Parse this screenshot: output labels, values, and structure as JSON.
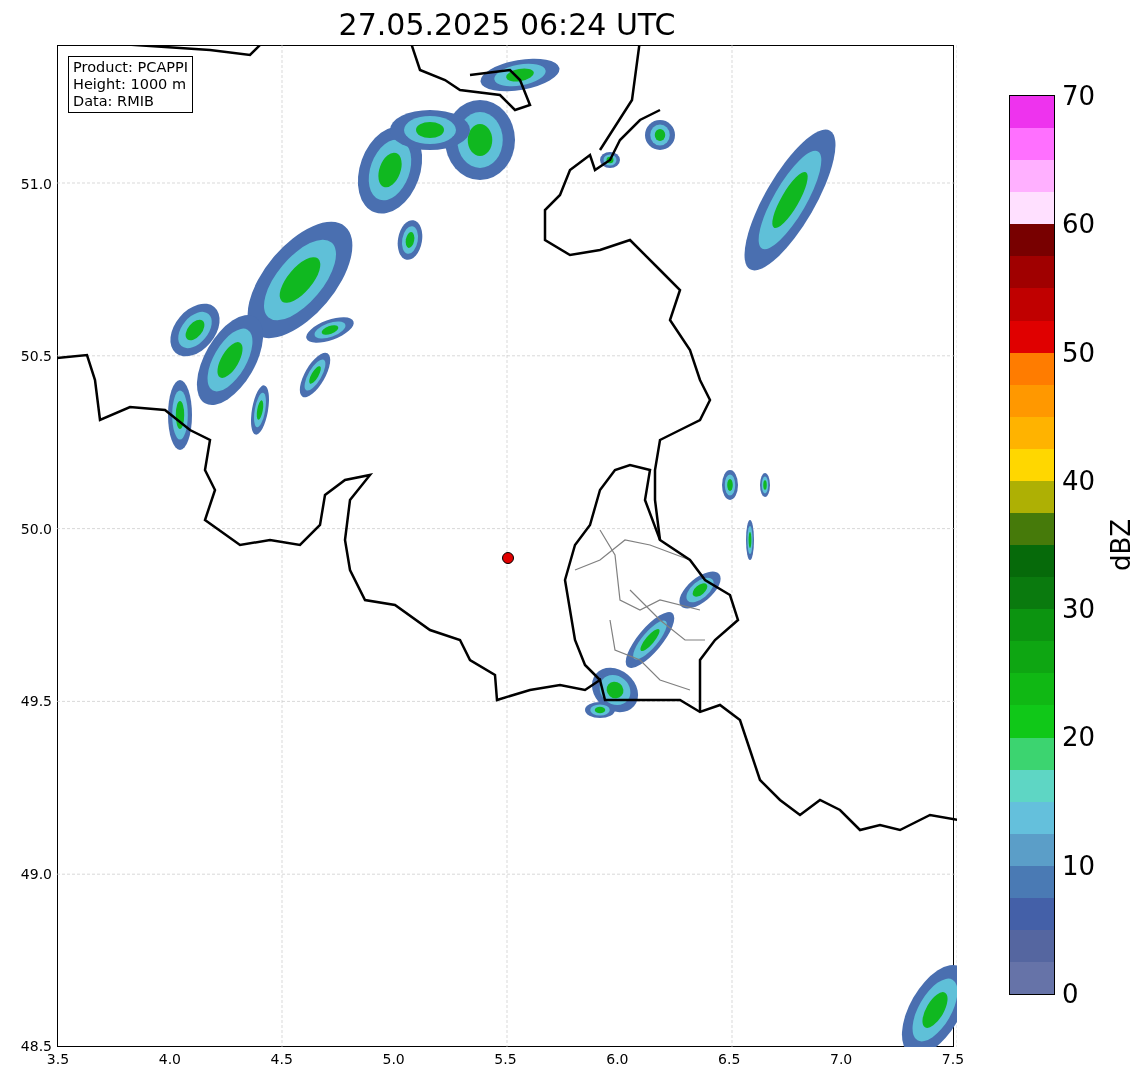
{
  "title": "27.05.2025 06:24 UTC",
  "info_box": [
    "Product: PCAPPI",
    "Height: 1000 m",
    "Data: RMIB"
  ],
  "map": {
    "xticks": [
      "3.5",
      "4.0",
      "4.5",
      "5.0",
      "5.5",
      "6.0",
      "6.5",
      "7.0",
      "7.5"
    ],
    "yticks": [
      "51.0",
      "50.5",
      "50.0",
      "49.5",
      "49.0",
      "48.5"
    ]
  },
  "colorbar": {
    "label": "dBZ",
    "ticks": [
      "70",
      "60",
      "50",
      "40",
      "30",
      "20",
      "10",
      "0"
    ],
    "segments": [
      {
        "color": "#6673a8"
      },
      {
        "color": "#5566a0"
      },
      {
        "color": "#4460a8"
      },
      {
        "color": "#4a7ab4"
      },
      {
        "color": "#5b9ec8"
      },
      {
        "color": "#64c0dc"
      },
      {
        "color": "#5ed6c4"
      },
      {
        "color": "#3cd470"
      },
      {
        "color": "#10c818"
      },
      {
        "color": "#10b814"
      },
      {
        "color": "#0ea612"
      },
      {
        "color": "#0c9410"
      },
      {
        "color": "#0a7a0e"
      },
      {
        "color": "#066a0a"
      },
      {
        "color": "#467a0a"
      },
      {
        "color": "#aeb004"
      },
      {
        "color": "#ffd700"
      },
      {
        "color": "#ffb300"
      },
      {
        "color": "#ff9800"
      },
      {
        "color": "#ff7c00"
      },
      {
        "color": "#e00000"
      },
      {
        "color": "#c00000"
      },
      {
        "color": "#a00000"
      },
      {
        "color": "#780000"
      },
      {
        "color": "#ffe0ff"
      },
      {
        "color": "#ffb0ff"
      },
      {
        "color": "#ff70ff"
      },
      {
        "color": "#ee33ee"
      }
    ]
  }
}
